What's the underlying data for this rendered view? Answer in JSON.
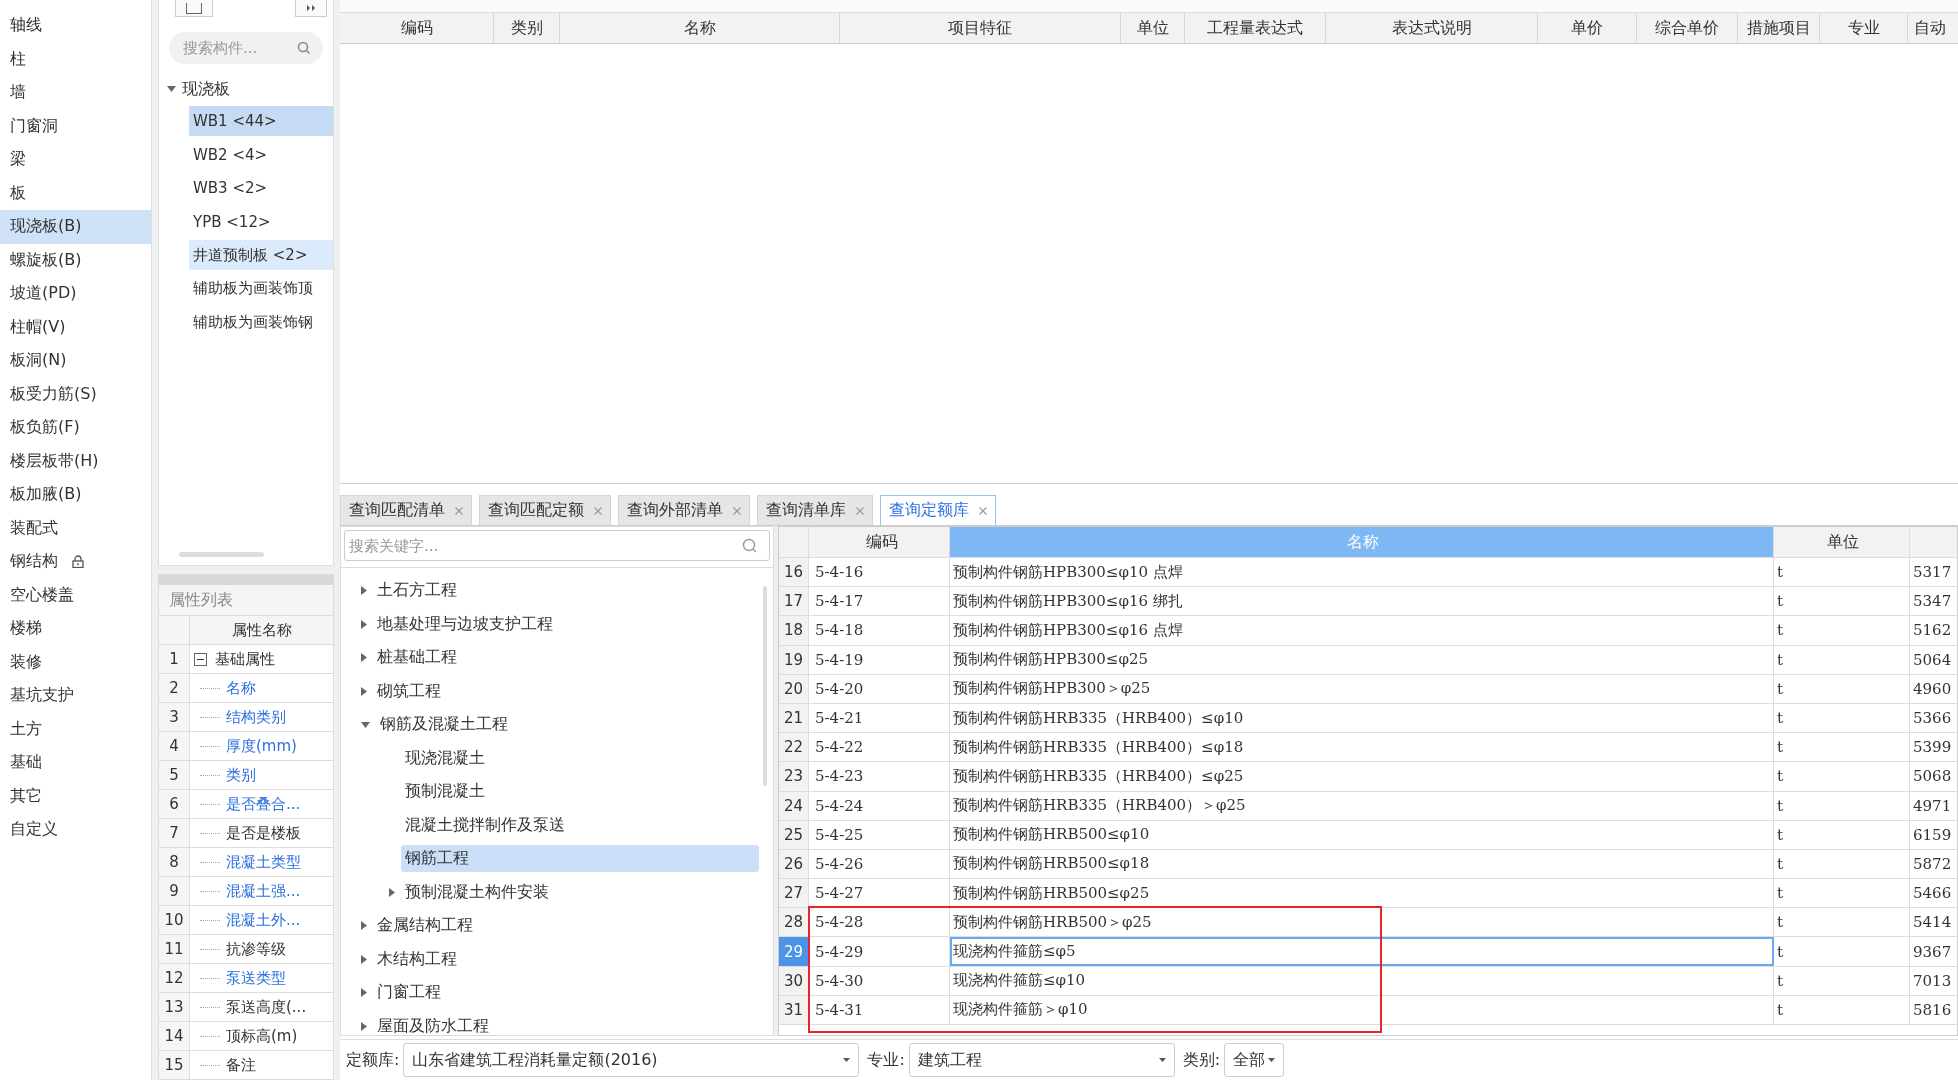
{
  "nav": {
    "items": [
      {
        "label": "轴线",
        "selected": false,
        "locked": false
      },
      {
        "label": "柱",
        "selected": false,
        "locked": false
      },
      {
        "label": "墙",
        "selected": false,
        "locked": false
      },
      {
        "label": "门窗洞",
        "selected": false,
        "locked": false
      },
      {
        "label": "梁",
        "selected": false,
        "locked": false
      },
      {
        "label": "板",
        "selected": false,
        "locked": false
      },
      {
        "label": "现浇板(B)",
        "selected": true,
        "locked": false
      },
      {
        "label": "螺旋板(B)",
        "selected": false,
        "locked": false
      },
      {
        "label": "坡道(PD)",
        "selected": false,
        "locked": false
      },
      {
        "label": "柱帽(V)",
        "selected": false,
        "locked": false
      },
      {
        "label": "板洞(N)",
        "selected": false,
        "locked": false
      },
      {
        "label": "板受力筋(S)",
        "selected": false,
        "locked": false
      },
      {
        "label": "板负筋(F)",
        "selected": false,
        "locked": false
      },
      {
        "label": "楼层板带(H)",
        "selected": false,
        "locked": false
      },
      {
        "label": "板加腋(B)",
        "selected": false,
        "locked": false
      },
      {
        "label": "装配式",
        "selected": false,
        "locked": false
      },
      {
        "label": "钢结构",
        "selected": false,
        "locked": true
      },
      {
        "label": "空心楼盖",
        "selected": false,
        "locked": false
      },
      {
        "label": "楼梯",
        "selected": false,
        "locked": false
      },
      {
        "label": "装修",
        "selected": false,
        "locked": false
      },
      {
        "label": "基坑支护",
        "selected": false,
        "locked": false
      },
      {
        "label": "土方",
        "selected": false,
        "locked": false
      },
      {
        "label": "基础",
        "selected": false,
        "locked": false
      },
      {
        "label": "其它",
        "selected": false,
        "locked": false
      },
      {
        "label": "自定义",
        "selected": false,
        "locked": false
      }
    ]
  },
  "component_panel": {
    "search": {
      "placeholder": "搜索构件..."
    },
    "tree": [
      {
        "label": "现浇板",
        "expanded": true,
        "children": [
          {
            "label": "WB1 <44>",
            "selected": true,
            "hovered": false
          },
          {
            "label": "WB2 <4>",
            "selected": false,
            "hovered": false
          },
          {
            "label": "WB3 <2>",
            "selected": false,
            "hovered": false
          },
          {
            "label": "YPB <12>",
            "selected": false,
            "hovered": false
          },
          {
            "label": "井道预制板 <2>",
            "selected": false,
            "hovered": true
          },
          {
            "label": "辅助板为画装饰顶",
            "selected": false,
            "hovered": false
          },
          {
            "label": "辅助板为画装饰钢",
            "selected": false,
            "hovered": false
          }
        ]
      }
    ]
  },
  "property_list": {
    "title": "属性列表",
    "column": "属性名称",
    "rows": [
      {
        "number": "1",
        "label": "基础属性",
        "kind": "group",
        "expanded": true
      },
      {
        "number": "2",
        "label": "名称",
        "kind": "property",
        "highlighted": true
      },
      {
        "number": "3",
        "label": "结构类别",
        "kind": "property",
        "highlighted": true
      },
      {
        "number": "4",
        "label": "厚度(mm)",
        "kind": "property",
        "highlighted": true
      },
      {
        "number": "5",
        "label": "类别",
        "kind": "property",
        "highlighted": true
      },
      {
        "number": "6",
        "label": "是否叠合...",
        "kind": "property",
        "highlighted": true
      },
      {
        "number": "7",
        "label": "是否是楼板",
        "kind": "property",
        "highlighted": false
      },
      {
        "number": "8",
        "label": "混凝土类型",
        "kind": "property",
        "highlighted": true
      },
      {
        "number": "9",
        "label": "混凝土强...",
        "kind": "property",
        "highlighted": true
      },
      {
        "number": "10",
        "label": "混凝土外...",
        "kind": "property",
        "highlighted": true
      },
      {
        "number": "11",
        "label": "抗渗等级",
        "kind": "property",
        "highlighted": false
      },
      {
        "number": "12",
        "label": "泵送类型",
        "kind": "property",
        "highlighted": true
      },
      {
        "number": "13",
        "label": "泵送高度(...",
        "kind": "property",
        "highlighted": false
      },
      {
        "number": "14",
        "label": "顶标高(m)",
        "kind": "property",
        "highlighted": false
      },
      {
        "number": "15",
        "label": "备注",
        "kind": "property",
        "highlighted": false
      }
    ]
  },
  "upper_table": {
    "columns": [
      "编码",
      "类别",
      "名称",
      "项目特征",
      "单位",
      "工程量表达式",
      "表达式说明",
      "单价",
      "综合单价",
      "措施项目",
      "专业",
      "自动"
    ]
  },
  "query_tabs": [
    {
      "label": "查询匹配清单",
      "selected": false
    },
    {
      "label": "查询匹配定额",
      "selected": false
    },
    {
      "label": "查询外部清单",
      "selected": false
    },
    {
      "label": "查询清单库",
      "selected": false
    },
    {
      "label": "查询定额库",
      "selected": true
    }
  ],
  "chapter_tree": {
    "search": {
      "placeholder": "搜索关键字..."
    },
    "items": [
      {
        "label": "土石方工程",
        "expanded": false,
        "has_children": true
      },
      {
        "label": "地基处理与边坡支护工程",
        "expanded": false,
        "has_children": true
      },
      {
        "label": "桩基础工程",
        "expanded": false,
        "has_children": true
      },
      {
        "label": "砌筑工程",
        "expanded": false,
        "has_children": true
      },
      {
        "label": "钢筋及混凝土工程",
        "expanded": true,
        "has_children": true,
        "children": [
          {
            "label": "现浇混凝土",
            "selected": false,
            "has_children": false
          },
          {
            "label": "预制混凝土",
            "selected": false,
            "has_children": false
          },
          {
            "label": "混凝土搅拌制作及泵送",
            "selected": false,
            "has_children": false
          },
          {
            "label": "钢筋工程",
            "selected": true,
            "has_children": false
          },
          {
            "label": "预制混凝土构件安装",
            "selected": false,
            "has_children": true
          }
        ]
      },
      {
        "label": "金属结构工程",
        "expanded": false,
        "has_children": true
      },
      {
        "label": "木结构工程",
        "expanded": false,
        "has_children": true
      },
      {
        "label": "门窗工程",
        "expanded": false,
        "has_children": true
      },
      {
        "label": "屋面及防水工程",
        "expanded": false,
        "has_children": true
      }
    ]
  },
  "quota_table": {
    "columns": [
      {
        "label": "编码",
        "selected": false
      },
      {
        "label": "名称",
        "selected": true
      },
      {
        "label": "单位",
        "selected": false
      }
    ],
    "rows": [
      {
        "number": "16",
        "code": "5-4-16",
        "name": "预制构件钢筋HPB300≤φ10 点焊",
        "unit": "t",
        "column_4": "5317",
        "selected": false,
        "marked": false
      },
      {
        "number": "17",
        "code": "5-4-17",
        "name": "预制构件钢筋HPB300≤φ16 绑扎",
        "unit": "t",
        "column_4": "5347",
        "selected": false,
        "marked": false
      },
      {
        "number": "18",
        "code": "5-4-18",
        "name": "预制构件钢筋HPB300≤φ16 点焊",
        "unit": "t",
        "column_4": "5162",
        "selected": false,
        "marked": false
      },
      {
        "number": "19",
        "code": "5-4-19",
        "name": "预制构件钢筋HPB300≤φ25",
        "unit": "t",
        "column_4": "5064",
        "selected": false,
        "marked": false
      },
      {
        "number": "20",
        "code": "5-4-20",
        "name": "预制构件钢筋HPB300＞φ25",
        "unit": "t",
        "column_4": "4960",
        "selected": false,
        "marked": false
      },
      {
        "number": "21",
        "code": "5-4-21",
        "name": "预制构件钢筋HRB335（HRB400）≤φ10",
        "unit": "t",
        "column_4": "5366",
        "selected": false,
        "marked": false
      },
      {
        "number": "22",
        "code": "5-4-22",
        "name": "预制构件钢筋HRB335（HRB400）≤φ18",
        "unit": "t",
        "column_4": "5399",
        "selected": false,
        "marked": false
      },
      {
        "number": "23",
        "code": "5-4-23",
        "name": "预制构件钢筋HRB335（HRB400）≤φ25",
        "unit": "t",
        "column_4": "5068",
        "selected": false,
        "marked": false
      },
      {
        "number": "24",
        "code": "5-4-24",
        "name": "预制构件钢筋HRB335（HRB400）＞φ25",
        "unit": "t",
        "column_4": "4971",
        "selected": false,
        "marked": false
      },
      {
        "number": "25",
        "code": "5-4-25",
        "name": "预制构件钢筋HRB500≤φ10",
        "unit": "t",
        "column_4": "6159",
        "selected": false,
        "marked": false
      },
      {
        "number": "26",
        "code": "5-4-26",
        "name": "预制构件钢筋HRB500≤φ18",
        "unit": "t",
        "column_4": "5872",
        "selected": false,
        "marked": false
      },
      {
        "number": "27",
        "code": "5-4-27",
        "name": "预制构件钢筋HRB500≤φ25",
        "unit": "t",
        "column_4": "5466",
        "selected": false,
        "marked": false
      },
      {
        "number": "28",
        "code": "5-4-28",
        "name": "预制构件钢筋HRB500＞φ25",
        "unit": "t",
        "column_4": "5414",
        "selected": false,
        "marked": true
      },
      {
        "number": "29",
        "code": "5-4-29",
        "name": "现浇构件箍筋≤φ5",
        "unit": "t",
        "column_4": "9367",
        "selected": true,
        "marked": true
      },
      {
        "number": "30",
        "code": "5-4-30",
        "name": "现浇构件箍筋≤φ10",
        "unit": "t",
        "column_4": "7013",
        "selected": false,
        "marked": true
      },
      {
        "number": "31",
        "code": "5-4-31",
        "name": "现浇构件箍筋＞φ10",
        "unit": "t",
        "column_4": "5816",
        "selected": false,
        "marked": true
      }
    ]
  },
  "filters": [
    {
      "label": "定额库:",
      "value": "山东省建筑工程消耗量定额(2016)",
      "kind": "wide"
    },
    {
      "label": "专业:",
      "value": "建筑工程",
      "kind": "medium"
    },
    {
      "label": "类别:",
      "value": "全部",
      "kind": "narrow"
    }
  ]
}
